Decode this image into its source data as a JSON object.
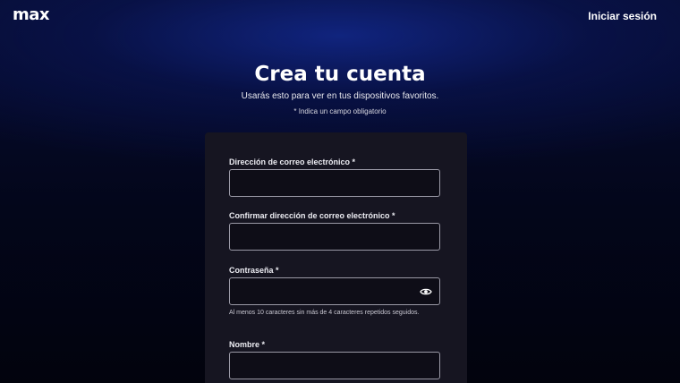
{
  "header": {
    "logo_text": "max",
    "signin_label": "Iniciar sesión"
  },
  "main": {
    "title": "Crea tu cuenta",
    "subtitle": "Usarás esto para ver en tus dispositivos favoritos.",
    "required_note": "* Indica un campo obligatorio"
  },
  "form": {
    "email_label": "Dirección de correo electrónico *",
    "email_value": "",
    "confirm_email_label": "Confirmar dirección de correo electrónico *",
    "confirm_email_value": "",
    "password_label": "Contraseña *",
    "password_value": "",
    "password_hint": "Al menos 10 caracteres sin más de 4 caracteres repetidos seguidos.",
    "password_toggle_icon": "eye-icon",
    "name_label": "Nombre *",
    "name_value": ""
  },
  "colors": {
    "card_background": "#161521",
    "input_border": "#9a99a6",
    "page_glow": "#12288c"
  }
}
